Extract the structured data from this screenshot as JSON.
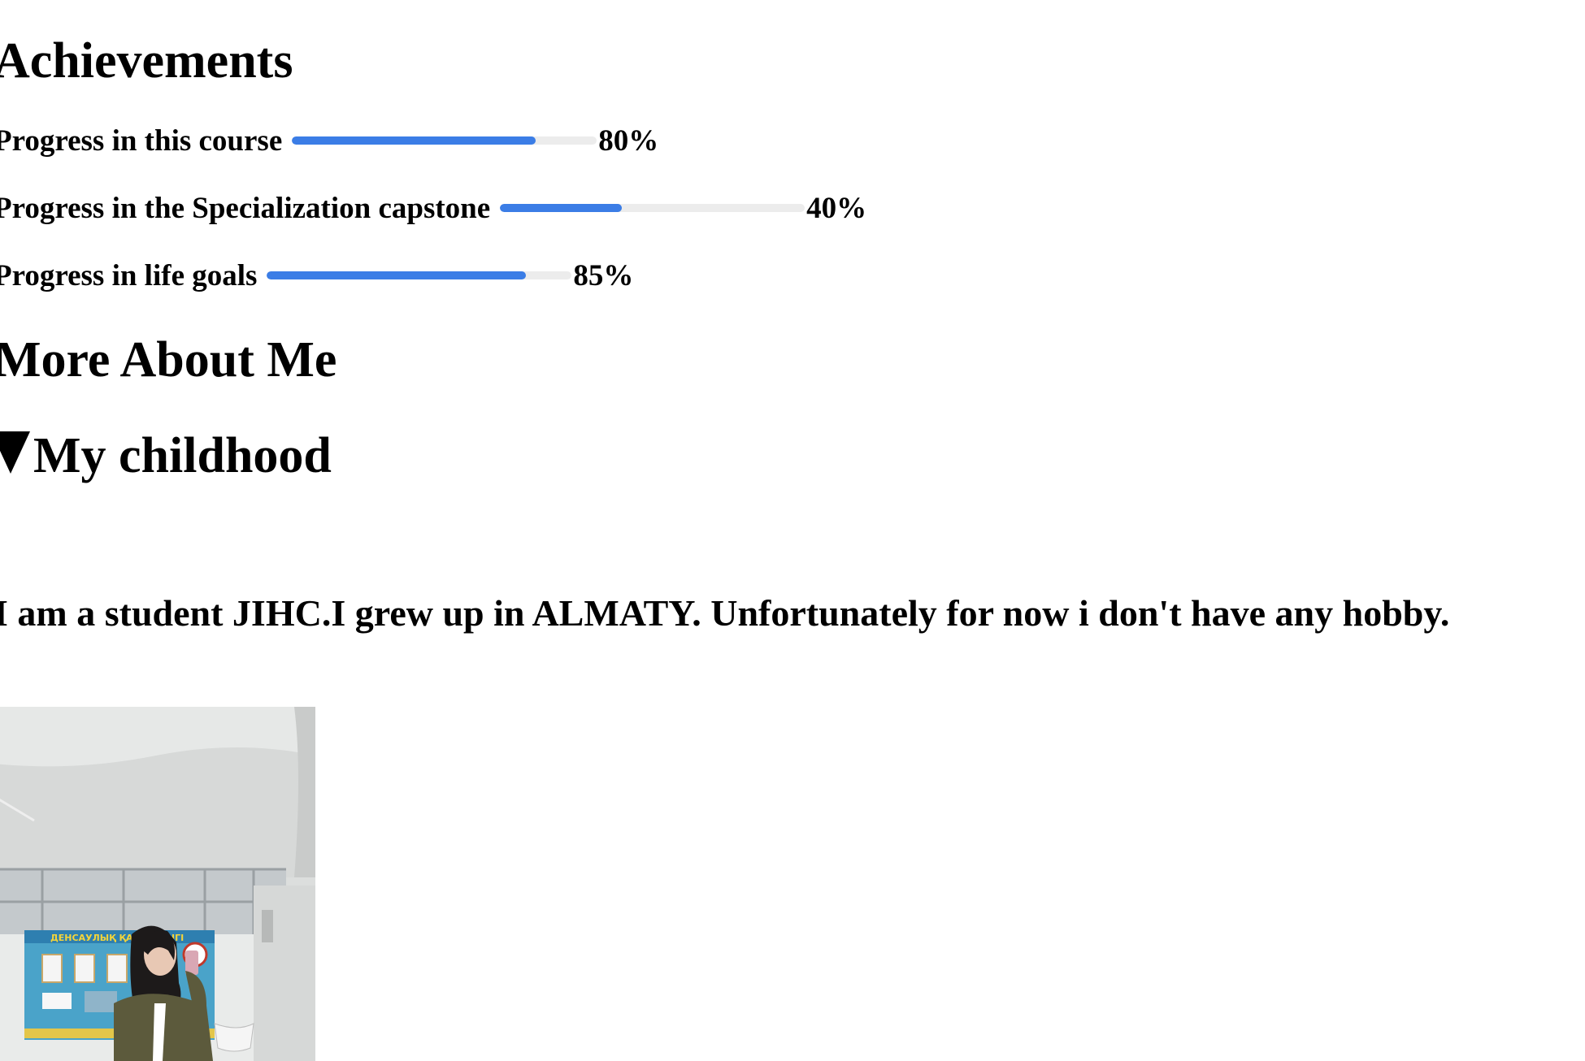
{
  "achievements": {
    "title": "Achievements",
    "items": [
      {
        "label": "Progress in this course",
        "percent": 80,
        "percent_label": "80%"
      },
      {
        "label": "Progress in the Specialization capstone",
        "percent": 40,
        "percent_label": "40%"
      },
      {
        "label": "Progress in life goals",
        "percent": 85,
        "percent_label": "85%"
      }
    ],
    "bar_color": "#3b7de6",
    "track_color": "#ececec"
  },
  "more_about": {
    "title": "More About Me",
    "details": {
      "summary": "My childhood",
      "open": true,
      "text": "I am a student JIHC.I grew up in ALMATY. Unfortunately for now i don't have any hobby.",
      "photo_alt": ""
    }
  },
  "photo_poster_text": "ДЕНСАУЛЫҚ ҚАУПСІЗДІГІ"
}
